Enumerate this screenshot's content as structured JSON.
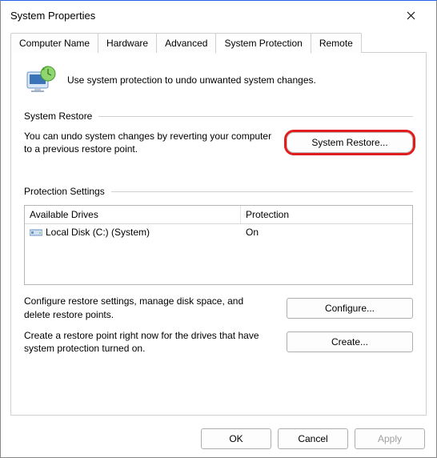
{
  "window": {
    "title": "System Properties"
  },
  "tabs": {
    "computer_name": "Computer Name",
    "hardware": "Hardware",
    "advanced": "Advanced",
    "system_protection": "System Protection",
    "remote": "Remote"
  },
  "intro": "Use system protection to undo unwanted system changes.",
  "restore": {
    "heading": "System Restore",
    "text": "You can undo system changes by reverting your computer to a previous restore point.",
    "button": "System Restore..."
  },
  "protection": {
    "heading": "Protection Settings",
    "col_drives": "Available Drives",
    "col_protection": "Protection",
    "rows": [
      {
        "name": "Local Disk (C:) (System)",
        "protection": "On"
      }
    ],
    "configure_text": "Configure restore settings, manage disk space, and delete restore points.",
    "configure_button": "Configure...",
    "create_text": "Create a restore point right now for the drives that have system protection turned on.",
    "create_button": "Create..."
  },
  "footer": {
    "ok": "OK",
    "cancel": "Cancel",
    "apply": "Apply"
  }
}
